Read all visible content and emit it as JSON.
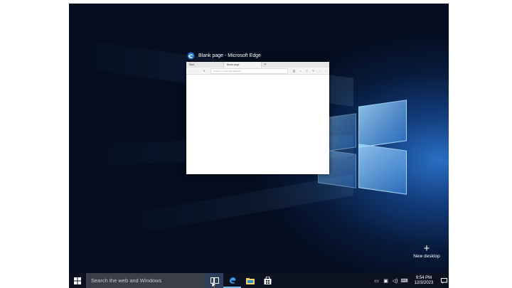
{
  "window": {
    "title": "Blank page - Microsoft Edge"
  },
  "browser": {
    "tabs": [
      {
        "label": "Start"
      },
      {
        "label": "Blank page"
      }
    ],
    "new_tab_label": "+",
    "address_placeholder": "Search or enter web address"
  },
  "desktop": {
    "new_desktop_plus": "+",
    "new_desktop_label": "New desktop"
  },
  "taskbar": {
    "search_placeholder": "Search the web and Windows",
    "clock_time": "9:54 PM",
    "clock_date": "12/3/2023",
    "apps": [
      "edge-icon",
      "file-explorer-icon",
      "store-icon"
    ]
  },
  "colors": {
    "accent": "#76b9ed",
    "taskbar_bg": "#0c1222",
    "desktop_bg": "#071a3a",
    "edge_blue": "#1e74c6"
  }
}
